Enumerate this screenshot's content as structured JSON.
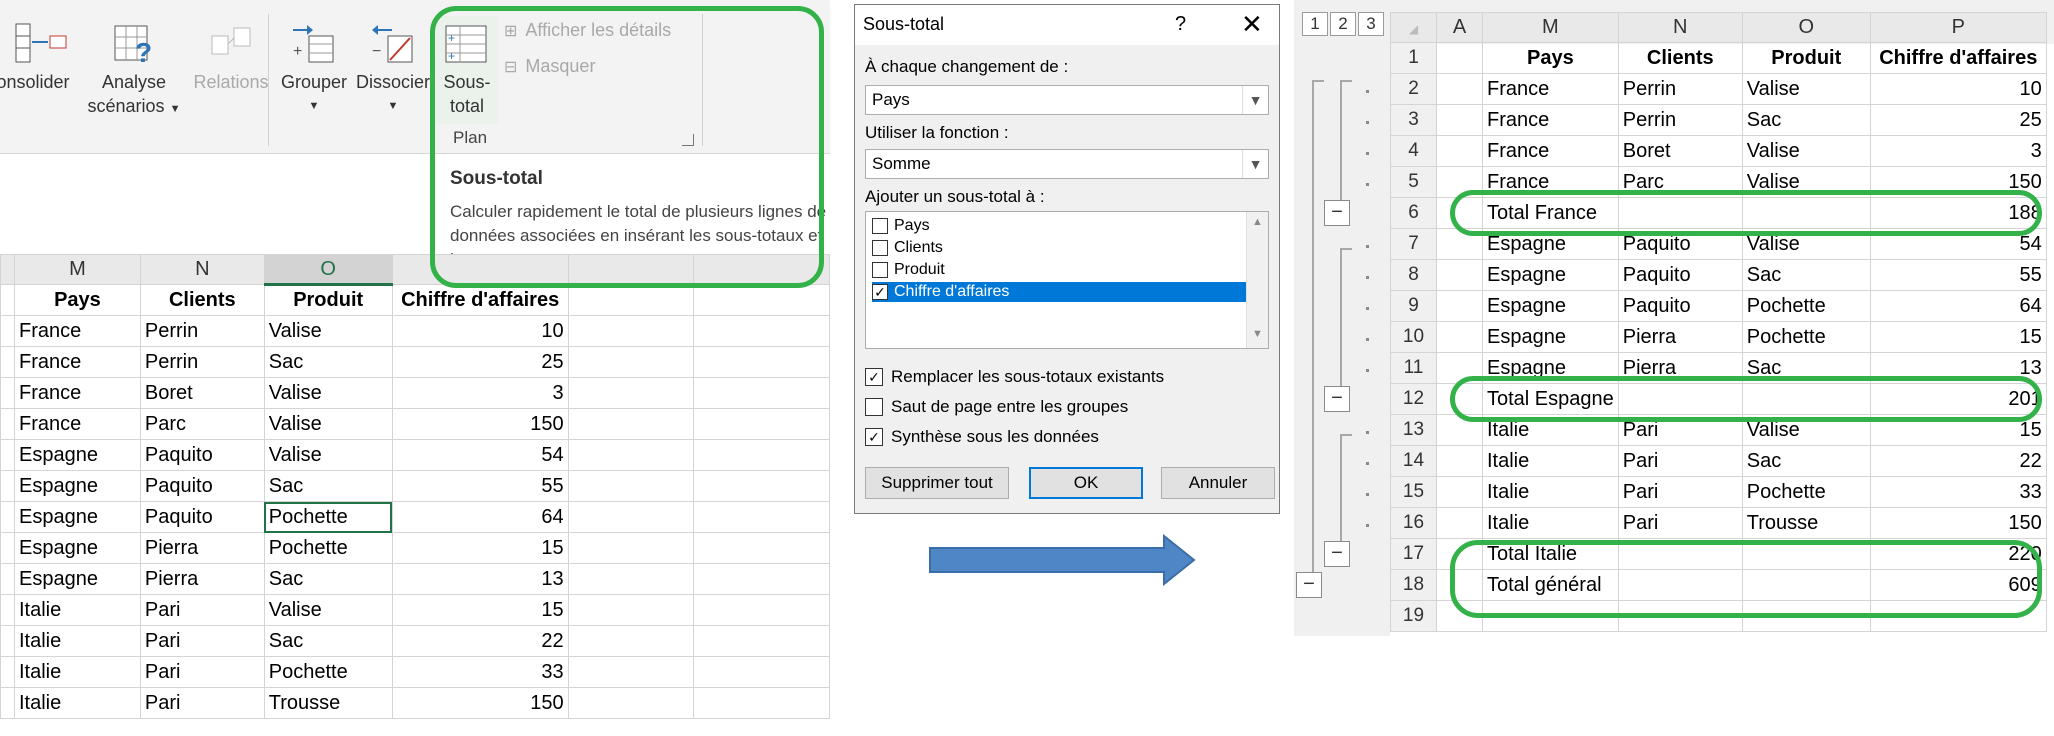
{
  "ribbon": {
    "consolider": "onsolider",
    "analyse_line1": "Analyse",
    "analyse_line2": "scénarios",
    "relations": "Relations",
    "grouper": "Grouper",
    "dissocier": "Dissocier",
    "sous_total_line1": "Sous-",
    "sous_total_line2": "total",
    "afficher_details": "Afficher les détails",
    "masquer": "Masquer",
    "group_label": "Plan"
  },
  "tooltip": {
    "title": "Sous-total",
    "text": "Calculer rapidement le total de plusieurs lignes de données associées en insérant les sous-totaux et les totaux."
  },
  "left_sheet": {
    "col_headers": [
      "M",
      "N",
      "O",
      ""
    ],
    "header_row": [
      "Pays",
      "Clients",
      "Produit",
      "Chiffre d'affaires"
    ],
    "rows": [
      [
        "France",
        "Perrin",
        "Valise",
        "10"
      ],
      [
        "France",
        "Perrin",
        "Sac",
        "25"
      ],
      [
        "France",
        "Boret",
        "Valise",
        "3"
      ],
      [
        "France",
        "Parc",
        "Valise",
        "150"
      ],
      [
        "Espagne",
        "Paquito",
        "Valise",
        "54"
      ],
      [
        "Espagne",
        "Paquito",
        "Sac",
        "55"
      ],
      [
        "Espagne",
        "Paquito",
        "Pochette",
        "64"
      ],
      [
        "Espagne",
        "Pierra",
        "Pochette",
        "15"
      ],
      [
        "Espagne",
        "Pierra",
        "Sac",
        "13"
      ],
      [
        "Italie",
        "Pari",
        "Valise",
        "15"
      ],
      [
        "Italie",
        "Pari",
        "Sac",
        "22"
      ],
      [
        "Italie",
        "Pari",
        "Pochette",
        "33"
      ],
      [
        "Italie",
        "Pari",
        "Trousse",
        "150"
      ]
    ]
  },
  "dialog": {
    "title": "Sous-total",
    "help": "?",
    "close": "✕",
    "label_change": "À chaque changement de :",
    "value_change": "Pays",
    "label_function": "Utiliser la fonction :",
    "value_function": "Somme",
    "label_add": "Ajouter un sous-total à :",
    "list_items": [
      {
        "label": "Pays",
        "checked": false
      },
      {
        "label": "Clients",
        "checked": false
      },
      {
        "label": "Produit",
        "checked": false
      },
      {
        "label": "Chiffre d'affaires",
        "checked": true
      }
    ],
    "opt_replace": "Remplacer les sous-totaux existants",
    "opt_pagebreak": "Saut de page entre les groupes",
    "opt_summary": "Synthèse sous les données",
    "btn_remove": "Supprimer tout",
    "btn_ok": "OK",
    "btn_cancel": "Annuler"
  },
  "right_sheet": {
    "levels": [
      "1",
      "2",
      "3"
    ],
    "col_headers": [
      "A",
      "M",
      "N",
      "O",
      "P"
    ],
    "rows": [
      {
        "n": "1",
        "cells": [
          "",
          "Pays",
          "Clients",
          "Produit",
          "Chiffre d'affaires"
        ],
        "type": "header"
      },
      {
        "n": "2",
        "cells": [
          "",
          "France",
          "Perrin",
          "Valise",
          "10"
        ]
      },
      {
        "n": "3",
        "cells": [
          "",
          "France",
          "Perrin",
          "Sac",
          "25"
        ]
      },
      {
        "n": "4",
        "cells": [
          "",
          "France",
          "Boret",
          "Valise",
          "3"
        ]
      },
      {
        "n": "5",
        "cells": [
          "",
          "France",
          "Parc",
          "Valise",
          "150"
        ]
      },
      {
        "n": "6",
        "cells": [
          "",
          "Total France",
          "",
          "",
          "188"
        ],
        "type": "total"
      },
      {
        "n": "7",
        "cells": [
          "",
          "Espagne",
          "Paquito",
          "Valise",
          "54"
        ]
      },
      {
        "n": "8",
        "cells": [
          "",
          "Espagne",
          "Paquito",
          "Sac",
          "55"
        ]
      },
      {
        "n": "9",
        "cells": [
          "",
          "Espagne",
          "Paquito",
          "Pochette",
          "64"
        ]
      },
      {
        "n": "10",
        "cells": [
          "",
          "Espagne",
          "Pierra",
          "Pochette",
          "15"
        ]
      },
      {
        "n": "11",
        "cells": [
          "",
          "Espagne",
          "Pierra",
          "Sac",
          "13"
        ]
      },
      {
        "n": "12",
        "cells": [
          "",
          "Total Espagne",
          "",
          "",
          "201"
        ],
        "type": "total"
      },
      {
        "n": "13",
        "cells": [
          "",
          "Italie",
          "Pari",
          "Valise",
          "15"
        ]
      },
      {
        "n": "14",
        "cells": [
          "",
          "Italie",
          "Pari",
          "Sac",
          "22"
        ]
      },
      {
        "n": "15",
        "cells": [
          "",
          "Italie",
          "Pari",
          "Pochette",
          "33"
        ]
      },
      {
        "n": "16",
        "cells": [
          "",
          "Italie",
          "Pari",
          "Trousse",
          "150"
        ]
      },
      {
        "n": "17",
        "cells": [
          "",
          "Total Italie",
          "",
          "",
          "220"
        ],
        "type": "total"
      },
      {
        "n": "18",
        "cells": [
          "",
          "Total général",
          "",
          "",
          "609"
        ],
        "type": "total"
      },
      {
        "n": "19",
        "cells": [
          "",
          "",
          "",
          "",
          ""
        ]
      }
    ]
  },
  "colors": {
    "highlight_green": "#34b24a",
    "arrow_blue": "#4f86c6",
    "excel_green": "#217346",
    "selection_blue": "#0078d7"
  }
}
